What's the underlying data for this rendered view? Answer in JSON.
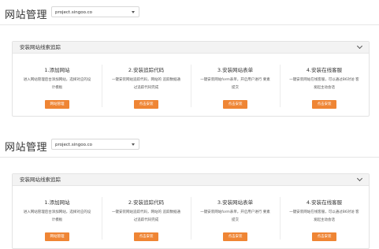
{
  "header": {
    "title": "网站管理",
    "site_select": "project.singoo.co"
  },
  "panel": {
    "title": "安装网站线索追踪"
  },
  "steps": [
    {
      "title": "1.添加网站",
      "desc": "进入网站管理后台添加网站，选择对应的设计模板",
      "button": "网站管理"
    },
    {
      "title": "2.安装追踪代码",
      "desc": "一键安装网站追踪代码，网站的 追踪数据通过追踪代码完成",
      "button": "点击安装"
    },
    {
      "title": "3.安装网站表单",
      "desc": "一键安装网站form表单，开启用户进行 要素提交",
      "button": "点击安装"
    },
    {
      "title": "4.安装在线客服",
      "desc": "一键安装网站在线客服，可以通过B6对访 客发起主动会话",
      "button": "点击安装"
    }
  ]
}
